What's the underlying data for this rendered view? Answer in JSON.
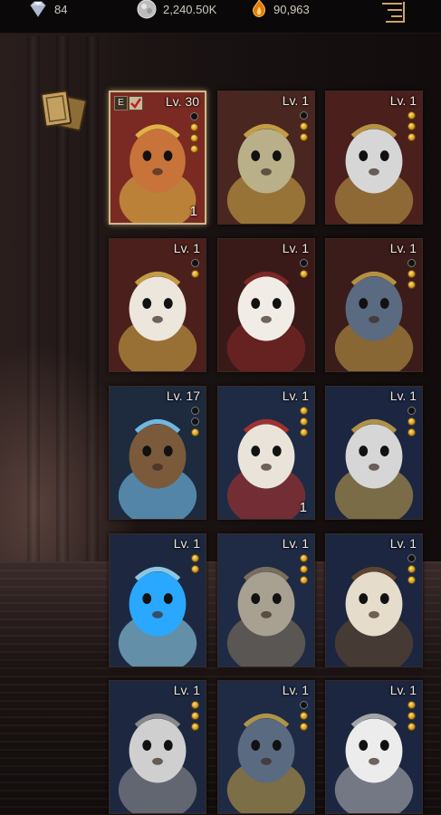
{
  "currencies": {
    "gem": {
      "value": "84",
      "icon": "diamond-icon"
    },
    "silver": {
      "value": "2,240.50K",
      "icon": "silver-coin-icon"
    },
    "flame": {
      "value": "90,963",
      "icon": "flame-gem-icon"
    }
  },
  "menu_icon": "menu-icon",
  "collection_icon": "cards-icon",
  "pets": [
    {
      "name": "squirrel",
      "level": "Lv. 30",
      "count": "1",
      "equipped_tag": "E",
      "selected": true,
      "slots": [
        "empty",
        "gold",
        "gold",
        "gold"
      ],
      "bg": "#7a2a22"
    },
    {
      "name": "armored-creature",
      "level": "Lv. 1",
      "count": "",
      "selected": false,
      "slots": [
        "empty",
        "gold",
        "gold"
      ],
      "bg": "#4a2620"
    },
    {
      "name": "armored-eagle",
      "level": "Lv. 1",
      "count": "",
      "selected": false,
      "slots": [
        "gold",
        "gold",
        "gold"
      ],
      "bg": "#4a1f1c"
    },
    {
      "name": "lamb",
      "level": "Lv. 1",
      "count": "",
      "selected": false,
      "slots": [
        "empty",
        "gold"
      ],
      "bg": "#4a1f1c"
    },
    {
      "name": "white-haired-doll",
      "level": "Lv. 1",
      "count": "",
      "selected": false,
      "slots": [
        "empty",
        "gold"
      ],
      "bg": "#3a1a18"
    },
    {
      "name": "masked-cat",
      "level": "Lv. 1",
      "count": "",
      "selected": false,
      "slots": [
        "empty",
        "gold",
        "gold"
      ],
      "bg": "#3b1c1a"
    },
    {
      "name": "tree-spirit",
      "level": "Lv. 17",
      "count": "",
      "selected": false,
      "slots": [
        "empty",
        "empty",
        "gold"
      ],
      "bg": "#1e2a3e"
    },
    {
      "name": "gnome",
      "level": "Lv. 1",
      "count": "1",
      "selected": false,
      "slots": [
        "gold",
        "gold",
        "gold"
      ],
      "bg": "#1f2a44"
    },
    {
      "name": "armored-eagle",
      "level": "Lv. 1",
      "count": "",
      "selected": false,
      "slots": [
        "empty",
        "gold",
        "gold"
      ],
      "bg": "#1c2640"
    },
    {
      "name": "blue-slime",
      "level": "Lv. 1",
      "count": "",
      "selected": false,
      "slots": [
        "gold",
        "gold"
      ],
      "bg": "#1d2840"
    },
    {
      "name": "otter",
      "level": "Lv. 1",
      "count": "",
      "selected": false,
      "slots": [
        "gold",
        "gold",
        "gold"
      ],
      "bg": "#1f2a44"
    },
    {
      "name": "goat",
      "level": "Lv. 1",
      "count": "",
      "selected": false,
      "slots": [
        "empty",
        "gold",
        "gold"
      ],
      "bg": "#1c2640"
    },
    {
      "name": "hamster",
      "level": "Lv. 1",
      "count": "",
      "selected": false,
      "slots": [
        "gold",
        "gold",
        "gold"
      ],
      "bg": "#1d2840"
    },
    {
      "name": "masked-cat",
      "level": "Lv. 1",
      "count": "",
      "selected": false,
      "slots": [
        "empty",
        "gold",
        "gold"
      ],
      "bg": "#1f2a44"
    },
    {
      "name": "polar-bear",
      "level": "Lv. 1",
      "count": "",
      "selected": false,
      "slots": [
        "gold",
        "gold",
        "gold"
      ],
      "bg": "#1c2640"
    }
  ]
}
